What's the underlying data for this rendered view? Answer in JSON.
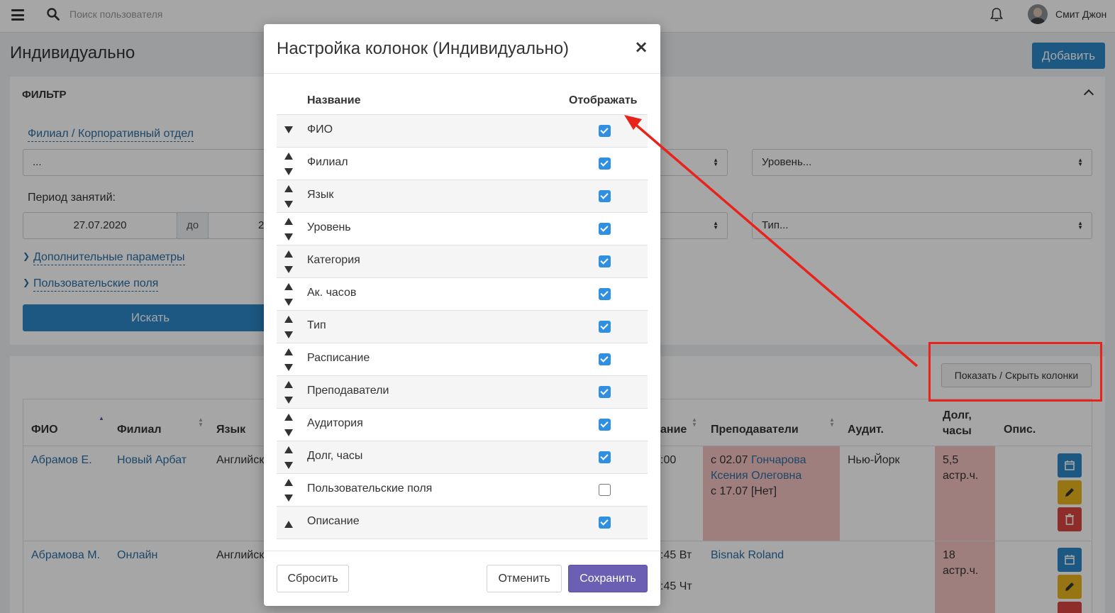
{
  "topbar": {
    "search_placeholder": "Поиск пользователя",
    "user_name": "Смит Джон"
  },
  "page": {
    "title": "Индивидуально",
    "add_label": "Добавить"
  },
  "filter": {
    "heading": "ФИЛЬТР",
    "branch_link": "Филиал / Корпоративный отдел",
    "branch_value": "...",
    "level_placeholder": "Уровень...",
    "type_placeholder": "Тип...",
    "period_label": "Период занятий:",
    "date_from": "27.07.2020",
    "do_label": "до",
    "date_to_partial": "2",
    "extra_params": "Дополнительные параметры",
    "custom_fields": "Пользовательские поля",
    "search_label": "Искать"
  },
  "results": {
    "show_hide_label": "Показать / Скрыть колонки",
    "headers": {
      "fio": "ФИО",
      "branch": "Филиал",
      "language": "Язык",
      "schedule_partial": "ание",
      "teachers": "Преподаватели",
      "room": "Аудит.",
      "debt_line1": "Долг,",
      "debt_line2": "часы",
      "desc": "Опис."
    },
    "rows": [
      {
        "fio": "Абрамов Е.",
        "branch": "Новый Арбат",
        "language": "Английск",
        "schedule": ":00",
        "teacher_line1": "с 02.07",
        "teacher_name": "Гончарова Ксения Олеговна",
        "teacher_line3": "с 17.07 [Нет]",
        "room": "Нью-Йорк",
        "debt_line1": "5,5",
        "debt_line2": "астр.ч."
      },
      {
        "fio": "Абрамова М.",
        "branch": "Онлайн",
        "language": "Английск",
        "schedule_line1": ":45 Вт",
        "schedule_line2": ":45 Чт",
        "teacher_name": "Bisnak Roland",
        "debt_line1": "18",
        "debt_line2": "астр.ч."
      }
    ]
  },
  "modal": {
    "title": "Настройка колонок (Индивидуально)",
    "close_label": "×",
    "col_header_name": "Название",
    "col_header_show": "Отображать",
    "columns": [
      {
        "label": "ФИО",
        "visible": true,
        "up": false,
        "down": true
      },
      {
        "label": "Филиал",
        "visible": true,
        "up": true,
        "down": true
      },
      {
        "label": "Язык",
        "visible": true,
        "up": true,
        "down": true
      },
      {
        "label": "Уровень",
        "visible": true,
        "up": true,
        "down": true
      },
      {
        "label": "Категория",
        "visible": true,
        "up": true,
        "down": true
      },
      {
        "label": "Ак. часов",
        "visible": true,
        "up": true,
        "down": true
      },
      {
        "label": "Тип",
        "visible": true,
        "up": true,
        "down": true
      },
      {
        "label": "Расписание",
        "visible": true,
        "up": true,
        "down": true
      },
      {
        "label": "Преподаватели",
        "visible": true,
        "up": true,
        "down": true
      },
      {
        "label": "Аудитория",
        "visible": true,
        "up": true,
        "down": true
      },
      {
        "label": "Долг, часы",
        "visible": true,
        "up": true,
        "down": true
      },
      {
        "label": "Пользовательские поля",
        "visible": false,
        "up": true,
        "down": true
      },
      {
        "label": "Описание",
        "visible": true,
        "up": true,
        "down": false
      }
    ],
    "reset_label": "Сбросить",
    "cancel_label": "Отменить",
    "save_label": "Сохранить"
  },
  "colors": {
    "primary": "#2b88c8",
    "save": "#6a5fb3",
    "checkbox": "#2f8fe0",
    "annotation": "#e8231c",
    "debt_highlight": "#f5c3c1"
  }
}
